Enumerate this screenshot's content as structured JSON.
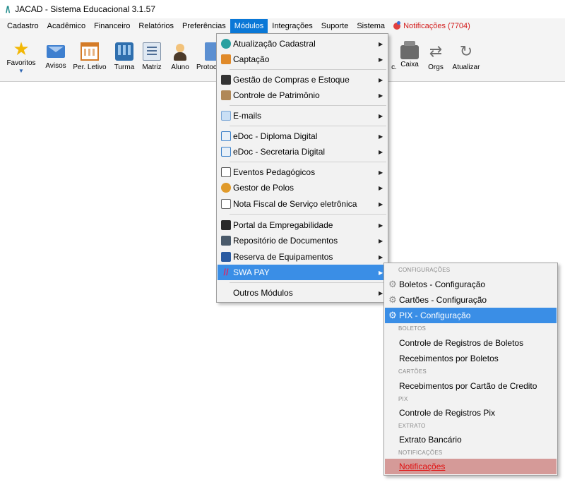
{
  "window": {
    "logo": "/\\",
    "title": "JACAD - Sistema Educacional 3.1.57"
  },
  "menubar": {
    "items": [
      "Cadastro",
      "Acadêmico",
      "Financeiro",
      "Relatórios",
      "Preferências",
      "Módulos",
      "Integrações",
      "Suporte",
      "Sistema"
    ],
    "active": "Módulos",
    "notifications": "Notificações (7704)"
  },
  "toolbar": {
    "favoritos": "Favoritos",
    "avisos": "Avisos",
    "per_letivo": "Per. Letivo",
    "turma": "Turma",
    "matriz": "Matriz",
    "aluno": "Aluno",
    "protocolo": "Protoc",
    "partial": "c.",
    "caixa": "Caixa",
    "orgs": "Orgs",
    "atualizar": "Atualizar"
  },
  "modulos_menu": {
    "items": [
      {
        "label": "Atualização Cadastral",
        "icon": "refresh-globe-icon",
        "has_submenu": true
      },
      {
        "label": "Captação",
        "icon": "funnel-icon",
        "has_submenu": true
      },
      {
        "label": "Gestão de Compras e Estoque",
        "icon": "shopping-icon",
        "has_submenu": true
      },
      {
        "label": "Controle de Patrimônio",
        "icon": "building-icon",
        "has_submenu": true
      },
      {
        "label": "E-mails",
        "icon": "email-icon",
        "has_submenu": true
      },
      {
        "label": "eDoc - Diploma Digital",
        "icon": "document-icon",
        "has_submenu": true
      },
      {
        "label": "eDoc - Secretaria Digital",
        "icon": "document-icon",
        "has_submenu": true
      },
      {
        "label": "Eventos Pedagógicos",
        "icon": "calendar-icon",
        "has_submenu": true
      },
      {
        "label": "Gestor de Polos",
        "icon": "pole-icon",
        "has_submenu": true
      },
      {
        "label": "Nota Fiscal de Serviço eletrônica",
        "icon": "invoice-icon",
        "has_submenu": true
      },
      {
        "label": "Portal da Empregabilidade",
        "icon": "briefcase-icon",
        "has_submenu": true
      },
      {
        "label": "Repositório de Documentos",
        "icon": "folder-icon",
        "has_submenu": true
      },
      {
        "label": "Reserva de Equipamentos",
        "icon": "monitor-icon",
        "has_submenu": true
      },
      {
        "label": "SWA PAY",
        "icon": "swa-pay-icon",
        "has_submenu": true,
        "highlighted": true
      },
      {
        "label": "Outros Módulos",
        "icon": "",
        "has_submenu": true
      }
    ]
  },
  "swapay_submenu": {
    "headers": [
      "CONFIGURAÇÕES",
      "BOLETOS",
      "CARTÕES",
      "PIX",
      "EXTRATO",
      "NOTIFICAÇÕES"
    ],
    "items": [
      {
        "label": "Boletos - Configuração",
        "icon": "gear-icon"
      },
      {
        "label": "Cartões - Configuração",
        "icon": "gear-icon"
      },
      {
        "label": "PIX - Configuração",
        "icon": "gear-icon",
        "highlighted": true
      },
      {
        "label": "Controle de Registros de Boletos"
      },
      {
        "label": "Recebimentos por Boletos"
      },
      {
        "label": "Recebimentos por Cartão de Credito"
      },
      {
        "label": "Controle de Registros Pix"
      },
      {
        "label": "Extrato Bancário"
      },
      {
        "label": "Notificações",
        "alert": true
      }
    ]
  },
  "colors": {
    "highlight": "#3a8ee6",
    "menu_active": "#0a78d7",
    "notification_text": "#d21a1a",
    "alert_bg": "#d59a98"
  }
}
